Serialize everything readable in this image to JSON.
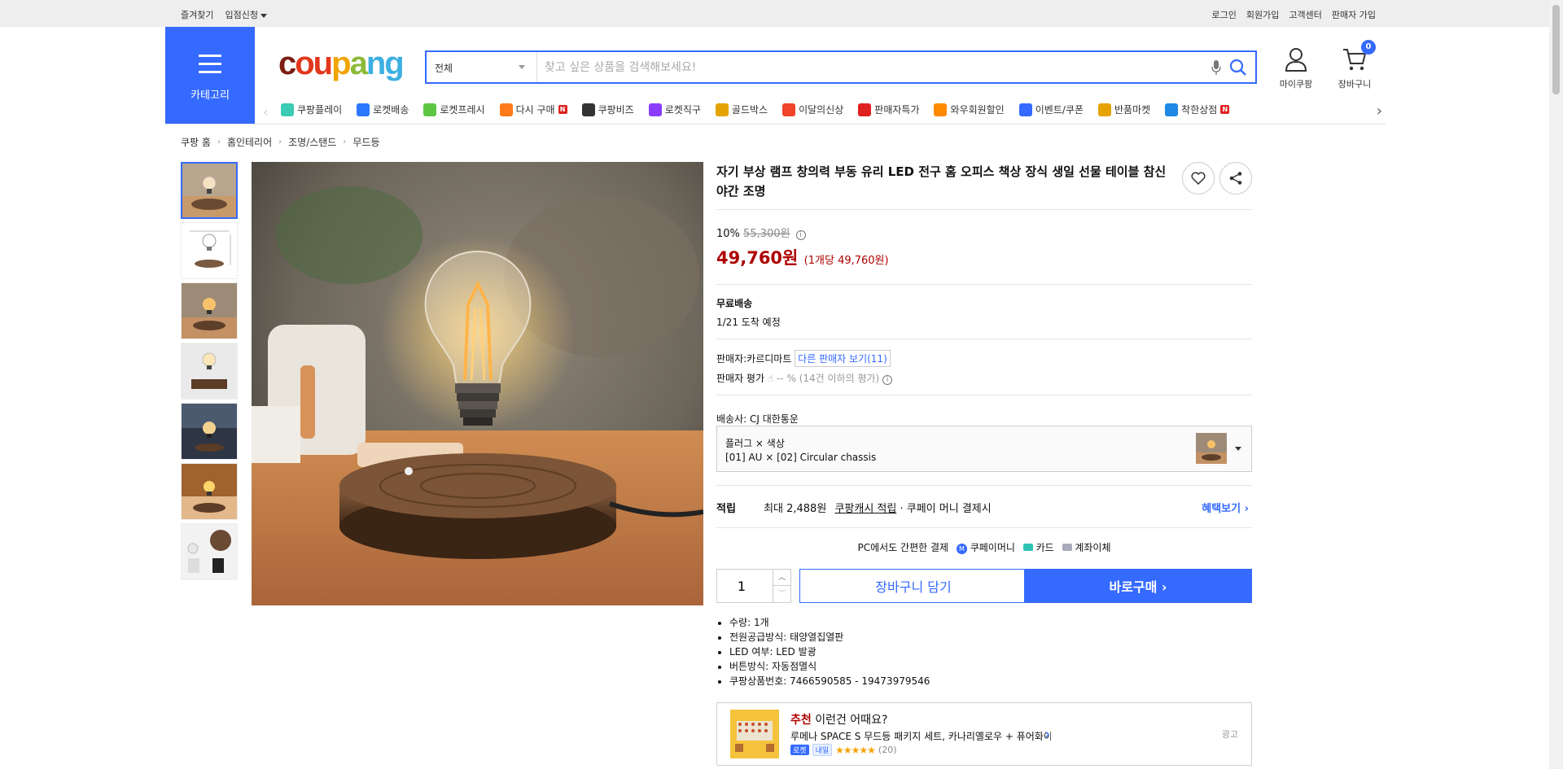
{
  "topbar": {
    "left": [
      "즐겨찾기",
      "입점신청"
    ],
    "right": [
      "로그인",
      "회원가입",
      "고객센터",
      "판매자 가입"
    ]
  },
  "category_button": {
    "label": "카테고리"
  },
  "logo": {
    "text": "coupang"
  },
  "search": {
    "category_value": "전체",
    "placeholder": "찾고 싶은 상품을 검색해보세요!"
  },
  "header": {
    "mycoupang_label": "마이쿠팡",
    "cart_label": "장바구니",
    "cart_count": "0"
  },
  "nav": {
    "items": [
      {
        "label": "쿠팡플레이",
        "icon": "play-icon",
        "color": "#3ccbb4"
      },
      {
        "label": "로켓배송",
        "icon": "rocket-icon",
        "color": "#2b78ff"
      },
      {
        "label": "로켓프레시",
        "icon": "rocket-fresh-icon",
        "color": "#5ec642"
      },
      {
        "label": "다시 구매",
        "icon": "rebuy-icon",
        "color": "#ff7a1a",
        "badge": "N"
      },
      {
        "label": "쿠팡비즈",
        "icon": "biz-icon",
        "color": "#333333",
        "prefix": "biz"
      },
      {
        "label": "로켓직구",
        "icon": "global-icon",
        "color": "#8a3dff"
      },
      {
        "label": "골드박스",
        "icon": "goldbox-icon",
        "color": "#e3a300"
      },
      {
        "label": "이달의신상",
        "icon": "new-icon",
        "color": "#f0442b"
      },
      {
        "label": "판매자특가",
        "icon": "percent-icon",
        "color": "#e02020"
      },
      {
        "label": "와우회원할인",
        "icon": "wow-icon",
        "color": "#ff8a00"
      },
      {
        "label": "이벤트/쿠폰",
        "icon": "coupon-icon",
        "color": "#346aff"
      },
      {
        "label": "반품마켓",
        "icon": "market-icon",
        "color": "#e6a300"
      },
      {
        "label": "착한상점",
        "icon": "shop-icon",
        "color": "#1e88e5",
        "badge": "N"
      }
    ]
  },
  "breadcrumb": [
    "쿠팡 홈",
    "홈인테리어",
    "조명/스탠드",
    "무드등"
  ],
  "product": {
    "title": "자기 부상 램프 창의력 부동 유리 LED 전구 홈 오피스 책상 장식 생일 선물 테이블 참신 야간 조명",
    "discount_rate": "10%",
    "original_price": "55,300원",
    "price": "49,760원",
    "unit_price": "(1개당 49,760원)",
    "shipping_title": "무료배송",
    "arrival": "1/21 도착 예정",
    "seller_label": "판매자:",
    "seller_name": "카르디마트",
    "other_sellers": "다른 판매자 보기(11)",
    "seller_rating_label": "판매자 평가",
    "seller_rating_value": "-- %",
    "seller_rating_note": "(14건 이하의 평가)",
    "courier": "배송사:  CJ 대한통운",
    "option_label": "플러그 × 색상",
    "option_value": "[01] AU × [02] Circular chassis",
    "points_label": "적립",
    "points_text_1": "최대 2,488원",
    "points_link": "쿠팡캐시 적립",
    "points_text_2": "· 쿠페이 머니 결제시",
    "benefit_link": "혜택보기",
    "pay_intro": "PC에서도 간편한 결제",
    "pay_methods": [
      "쿠페이머니",
      "카드",
      "계좌이체"
    ],
    "quantity": "1",
    "add_to_cart": "장바구니 담기",
    "buy_now": "바로구매",
    "specs": [
      "수량: 1개",
      "전원공급방식: 태양열집열판",
      "LED 여부: LED 발광",
      "버튼방식: 자동점멸식",
      "쿠팡상품번호: 7466590585 - 19473979546"
    ]
  },
  "recommend": {
    "title_red": "추천",
    "title_rest": " 이런건 어때요?",
    "desc": "루메나 SPACE S 무드등 패키지 세트, 카나리옐로우 + 퓨어화이트",
    "rocket": "로켓",
    "tomorrow": "내일",
    "reviews": "(20)",
    "ad_label": "광고"
  }
}
